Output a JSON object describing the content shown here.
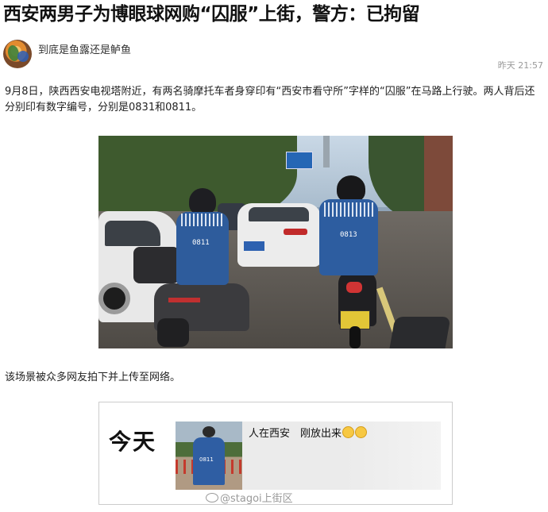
{
  "article": {
    "headline": "西安两男子为博眼球网购“囚服”上街，警方：已拘留",
    "author": "到底是鱼露还是鲈鱼",
    "time": "昨天 21:57",
    "paragraph1": "9月8日，陕西西安电视塔附近，有两名骑摩托车者身穿印有“西安市看守所”字样的“囚服”在马路上行驶。两人背后还分别印有数字编号，分别是0831和0811。",
    "paragraph2": "该场景被众多网友拍下并上传至网络。"
  },
  "photo1": {
    "rider_left_code": "0811",
    "rider_right_code": "0813"
  },
  "photo2": {
    "today": "今天",
    "chat_text": "人在西安　刚放出来",
    "thumb_code": "0811",
    "watermark": "@stagoi上街区"
  },
  "colors": {
    "uniform_blue": "#2e5c9c",
    "plate_yellow": "#e2c637"
  }
}
